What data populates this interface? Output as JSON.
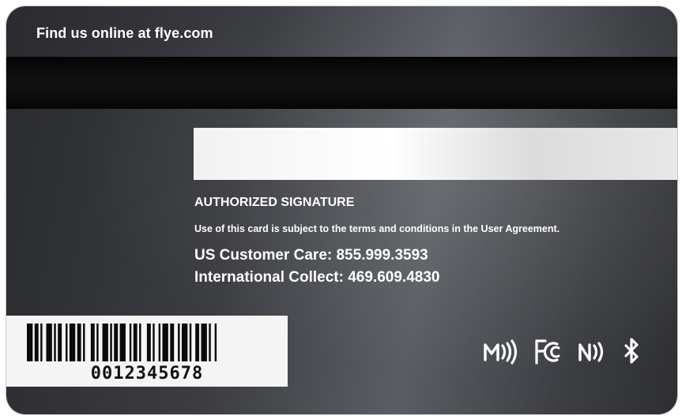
{
  "card": {
    "header_link": "Find us online at flye.com",
    "signature_label": "AUTHORIZED SIGNATURE",
    "terms_text": "Use of this card is subject to the terms and conditions in the User Agreement.",
    "us_customer_care": "US Customer Care: 855.999.3593",
    "international_collect": "International Collect: 469.609.4830",
    "barcode_number": "0012345678"
  },
  "icons": [
    "mastercard-contactless-icon",
    "fcc-icon",
    "nfc-icon",
    "bluetooth-icon"
  ],
  "colors": {
    "card_base": "#3a3c41",
    "stripe": "#0a0a0a",
    "text": "#ffffff",
    "signature_panel": "#f2f2f2"
  }
}
